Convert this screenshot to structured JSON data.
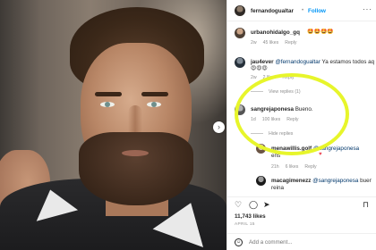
{
  "post": {
    "arrow_glyph": "›"
  },
  "header": {
    "username": "fernandogualtar",
    "separator": "•",
    "follow_label": "Follow",
    "more_glyph": "···"
  },
  "comments": [
    {
      "username": "urbanohidalgo_gq",
      "text": "🤩🤩🤩🤩",
      "age": "2w",
      "likes": "45 likes",
      "reply_label": "Reply"
    },
    {
      "username": "jau4ever",
      "mention": "@fernandogualtar",
      "text": " Ya estamos todos aq",
      "text2": "😍😍😍",
      "age": "2w",
      "likes": "2 likes",
      "reply_label": "Reply",
      "view_replies": "View replies (1)"
    },
    {
      "username": "sangrejaponesa",
      "text": "Bueno.",
      "age": "1d",
      "likes": "100 likes",
      "reply_label": "Reply",
      "hide_replies": "Hide replies"
    },
    {
      "username": "menawillis.golf",
      "mention": "@sangrejaponesa",
      "text": "ens",
      "age": "21h",
      "likes": "6 likes",
      "reply_label": "Reply",
      "heart": "♥"
    },
    {
      "username": "macagimenezz",
      "mention": "@sangrejaponesa",
      "text": " buen",
      "text2": "reina"
    }
  ],
  "actions": {
    "like_glyph": "♡",
    "comment_glyph": "◯",
    "share_glyph": "➤",
    "save_glyph": "⊓"
  },
  "likes_count": "11,743 likes",
  "time_ago": "APRIL 15",
  "comment_box": {
    "emoji_glyph": "☺",
    "placeholder": "Add a comment..."
  },
  "colors": {
    "highlight": "#e7f52b",
    "link": "#0095f6",
    "mention": "#00376b"
  }
}
